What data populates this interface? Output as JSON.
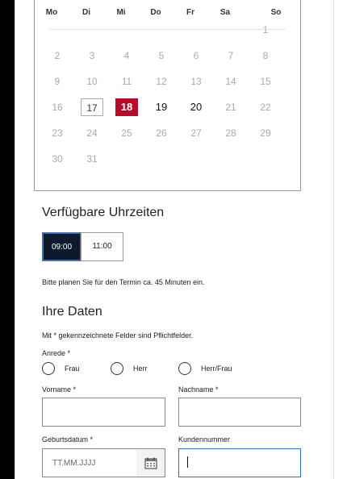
{
  "calendar": {
    "weekdays": [
      "Mo",
      "Di",
      "Mi",
      "Do",
      "Fr",
      "Sa",
      "So"
    ],
    "days": [
      "1",
      "2",
      "3",
      "4",
      "5",
      "6",
      "7",
      "8",
      "9",
      "10",
      "11",
      "12",
      "13",
      "14",
      "15",
      "16",
      "17",
      "18",
      "19",
      "20",
      "21",
      "22",
      "23",
      "24",
      "25",
      "26",
      "27",
      "28",
      "29",
      "30",
      "31"
    ],
    "today": "17",
    "selected": "18",
    "available": [
      "18",
      "19",
      "20"
    ]
  },
  "times": {
    "title": "Verfügbare Uhrzeiten",
    "slots": [
      "09:00",
      "11:00"
    ],
    "selected": "09:00",
    "note": "Bitte planen Sie für den Termin ca. 45 Minuten ein."
  },
  "personal": {
    "title": "Ihre Daten",
    "required_note": "Mit * gekennzeichnete Felder sind Pflichtfelder.",
    "salutation_label": "Anrede *",
    "salutation_options": [
      "Frau",
      "Herr",
      "Herr/Frau"
    ],
    "firstname_label": "Vorname *",
    "lastname_label": "Nachname *",
    "birthdate_label": "Geburtsdatum *",
    "birthdate_placeholder": "TT.MM.JJJJ",
    "customer_number_label": "Kundennummer"
  },
  "colors": {
    "selected_day": "#b50d2a",
    "selected_slot": "#0d1a2e",
    "focus_border": "#2f6fba"
  }
}
